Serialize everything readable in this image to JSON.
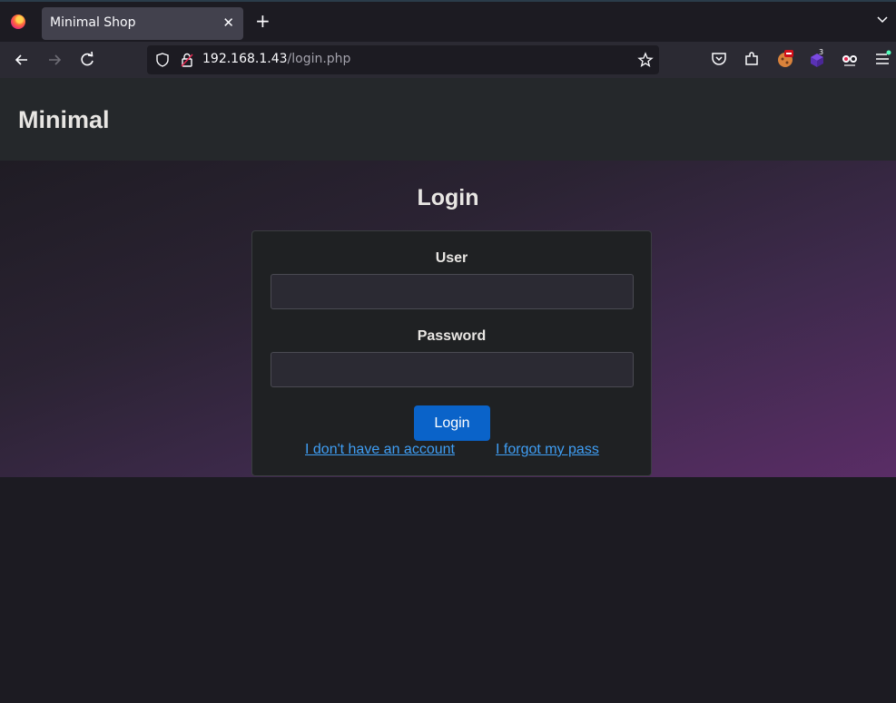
{
  "browser": {
    "tab_title": "Minimal Shop",
    "tab_close": "✕",
    "new_tab": "+",
    "url_host": "192.168.1.43",
    "url_path": "/login.php",
    "extension_badge": "3"
  },
  "site": {
    "brand": "Minimal"
  },
  "login": {
    "title": "Login",
    "user_label": "User",
    "user_value": "",
    "password_label": "Password",
    "password_value": "",
    "submit_label": "Login",
    "no_account_link": "I don't have an account",
    "forgot_link": "I forgot my pass"
  },
  "colors": {
    "accent": "#0a63c9",
    "link": "#3f9ef4"
  }
}
